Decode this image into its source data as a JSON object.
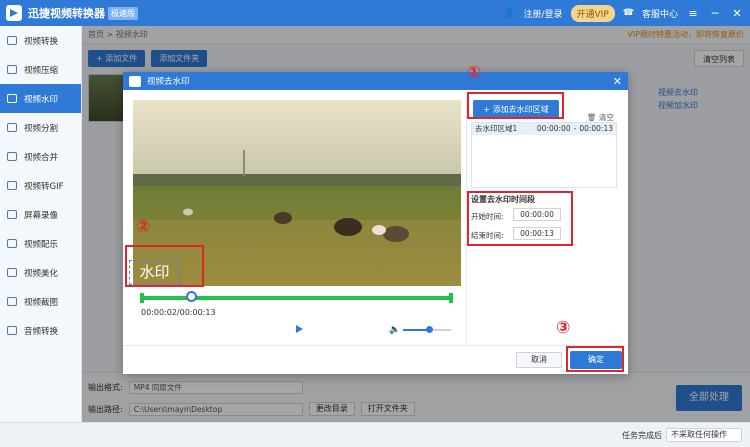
{
  "app": {
    "name": "迅捷视频转换器",
    "badge": "极速版",
    "login": "注册/登录",
    "vip": "开通VIP",
    "service": "客服中心",
    "window_controls": [
      "≡",
      "─",
      "✕"
    ]
  },
  "sidebar": {
    "items": [
      {
        "label": "视频转换",
        "icon": "convert-icon"
      },
      {
        "label": "视频压缩",
        "icon": "compress-icon"
      },
      {
        "label": "视频水印",
        "icon": "watermark-icon",
        "active": true
      },
      {
        "label": "视频分割",
        "icon": "split-icon"
      },
      {
        "label": "视频合并",
        "icon": "merge-icon"
      },
      {
        "label": "视频转GIF",
        "icon": "gif-icon"
      },
      {
        "label": "屏幕录像",
        "icon": "record-icon"
      },
      {
        "label": "视频配乐",
        "icon": "music-icon"
      },
      {
        "label": "视频美化",
        "icon": "beautify-icon"
      },
      {
        "label": "视频截图",
        "icon": "screenshot-icon"
      },
      {
        "label": "音频转换",
        "icon": "audio-icon"
      }
    ]
  },
  "main": {
    "breadcrumb": "首页 > 视频水印",
    "promo": "VIP限时特惠活动，即将恢复原价",
    "add_file": "+ 添加文件",
    "add_folder": "添加文件夹",
    "clear_list": "清空列表",
    "right_labels": [
      "视频去水印",
      "视频加水印"
    ]
  },
  "bottom": {
    "format_label": "输出格式:",
    "format_value": "MP4  同原文件",
    "path_label": "输出路径:",
    "path_value": "C:\\Users\\mayn\\Desktop",
    "change_dir": "更改目录",
    "open_folder": "打开文件夹",
    "process_all": "全部处理",
    "after_done": "任务完成后",
    "after_done_value": "不采取任何操作"
  },
  "dialog": {
    "title": "视频去水印",
    "watermark_text": "水印",
    "time_readout": "00:00:02/00:00:13",
    "playhead_fraction": 0.16,
    "volume_fraction": 0.55,
    "add_area": "+ 添加去水印区域",
    "clear": "清空",
    "area_row": {
      "name": "去水印区域1",
      "start": "00:00:00",
      "sep": "-",
      "end": "00:00:13"
    },
    "set_title": "设置去水印时间段",
    "start_label": "开始时间:",
    "start_value": "00:00:00",
    "end_label": "结束时间:",
    "end_value": "00:00:13",
    "cancel": "取消",
    "confirm": "确定"
  },
  "annotations": [
    "①",
    "②",
    "③"
  ],
  "colors": {
    "accent": "#2f7ad6",
    "timeline": "#21c24b",
    "annotation": "#e0262d"
  }
}
